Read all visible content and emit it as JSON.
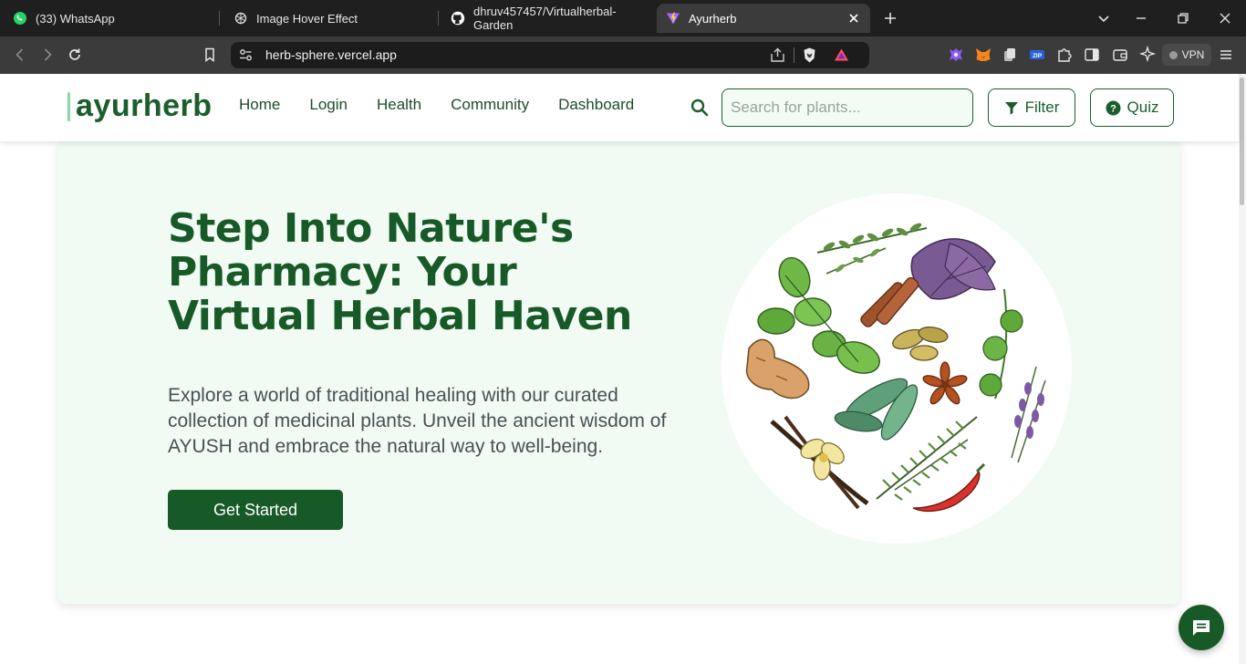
{
  "browser": {
    "tabs": [
      {
        "title": "(33) WhatsApp",
        "icon": "whatsapp-icon"
      },
      {
        "title": "Image Hover Effect",
        "icon": "chatgpt-icon"
      },
      {
        "title": "dhruv457457/Virtualherbal-Garden",
        "icon": "github-icon"
      },
      {
        "title": "Ayurherb",
        "icon": "vite-icon",
        "active": true
      }
    ],
    "url": "herb-sphere.vercel.app",
    "vpn_label": "VPN"
  },
  "nav": {
    "logo": "ayurherb",
    "links": [
      "Home",
      "Login",
      "Health",
      "Community",
      "Dashboard"
    ],
    "search_placeholder": "Search for plants...",
    "filter_label": "Filter",
    "quiz_label": "Quiz"
  },
  "hero": {
    "title": "Step Into Nature's Pharmacy: Your Virtual Herbal Haven",
    "description": "Explore a world of traditional healing with our curated collection of medicinal plants. Unveil the ancient wisdom of AYUSH and embrace the natural way to well-being.",
    "cta_label": "Get Started"
  },
  "colors": {
    "brand_green": "#175a27",
    "hero_bg": "#f1fbf3",
    "tab_bar": "#1f1f1f",
    "toolbar": "#3b3b3b"
  }
}
